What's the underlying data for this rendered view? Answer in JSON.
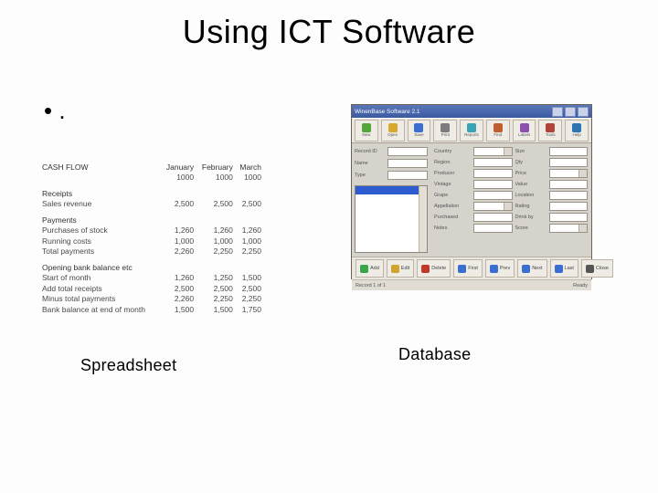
{
  "title": "Using ICT Software",
  "bullet": ".",
  "captions": {
    "left": "Spreadsheet",
    "right": "Database"
  },
  "spreadsheet": {
    "heading": "CASH FLOW",
    "months": [
      "January",
      "February",
      "March"
    ],
    "opening_balance_row": [
      "",
      "1000",
      "1000",
      "1000"
    ],
    "sections": {
      "receipts": {
        "title": "Receipts",
        "rows": [
          {
            "label": "Sales revenue",
            "vals": [
              "2,500",
              "2,500",
              "2,500"
            ]
          }
        ]
      },
      "payments": {
        "title": "Payments",
        "rows": [
          {
            "label": "Purchases of stock",
            "vals": [
              "1,260",
              "1,260",
              "1,260"
            ]
          },
          {
            "label": "Running costs",
            "vals": [
              "1,000",
              "1,000",
              "1,000"
            ]
          },
          {
            "label": "Total payments",
            "vals": [
              "2,260",
              "2,250",
              "2,250"
            ]
          }
        ]
      },
      "balances": {
        "title": "Opening bank balance etc",
        "rows": [
          {
            "label": "Start of month",
            "vals": [
              "1,260",
              "1,250",
              "1,500"
            ]
          },
          {
            "label": "Add total receipts",
            "vals": [
              "2,500",
              "2,500",
              "2,500"
            ]
          },
          {
            "label": "Minus total payments",
            "vals": [
              "2,260",
              "2,250",
              "2,250"
            ]
          },
          {
            "label": "Bank balance at end of month",
            "vals": [
              "1,500",
              "1,500",
              "1,750"
            ]
          }
        ]
      }
    }
  },
  "database": {
    "window_title": "WinenBase  Software 2.1",
    "toolbar": [
      {
        "label": "New",
        "name": "new-icon",
        "color": "#54a63a"
      },
      {
        "label": "Open",
        "name": "open-icon",
        "color": "#d9a92d"
      },
      {
        "label": "Save",
        "name": "save-icon",
        "color": "#3a6fd1"
      },
      {
        "label": "Print",
        "name": "print-icon",
        "color": "#7d7d7d"
      },
      {
        "label": "Reports",
        "name": "reports-icon",
        "color": "#38a3b5"
      },
      {
        "label": "Find",
        "name": "find-icon",
        "color": "#c05f2e"
      },
      {
        "label": "Labels",
        "name": "labels-icon",
        "color": "#8e4fb3"
      },
      {
        "label": "Tools",
        "name": "tools-icon",
        "color": "#b3433a"
      },
      {
        "label": "Help",
        "name": "help-icon",
        "color": "#2e74b3"
      }
    ],
    "left_fields": [
      {
        "label": "Record ID"
      },
      {
        "label": "Name"
      },
      {
        "label": "Type"
      }
    ],
    "right_fields": [
      {
        "label": "Country"
      },
      {
        "label": "Size"
      },
      {
        "label": "Region"
      },
      {
        "label": "Qty"
      },
      {
        "label": "Producer"
      },
      {
        "label": "Price"
      },
      {
        "label": "Vintage"
      },
      {
        "label": "Value"
      },
      {
        "label": "Grape"
      },
      {
        "label": "Location"
      },
      {
        "label": "Appellation"
      },
      {
        "label": "Rating"
      },
      {
        "label": "Purchased"
      },
      {
        "label": "Drink by"
      },
      {
        "label": "Notes"
      },
      {
        "label": "Score"
      }
    ],
    "bottom_buttons": [
      {
        "label": "Add",
        "name": "add-icon",
        "color": "#3aa64c"
      },
      {
        "label": "Edit",
        "name": "edit-icon",
        "color": "#d1a42f"
      },
      {
        "label": "Delete",
        "name": "delete-icon",
        "color": "#c0392b"
      },
      {
        "label": "First",
        "name": "first-icon",
        "color": "#3a6fd1"
      },
      {
        "label": "Prev",
        "name": "prev-icon",
        "color": "#3a6fd1"
      },
      {
        "label": "Next",
        "name": "next-icon",
        "color": "#3a6fd1"
      },
      {
        "label": "Last",
        "name": "last-icon",
        "color": "#3a6fd1"
      },
      {
        "label": "Close",
        "name": "close-icon",
        "color": "#555555"
      }
    ],
    "status_left": "Record 1 of 1",
    "status_right": "Ready"
  }
}
